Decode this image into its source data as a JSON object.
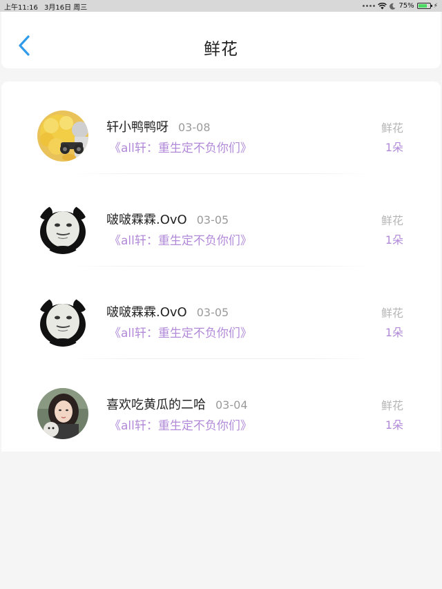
{
  "status_bar": {
    "time": "上午11:16",
    "date": "3月16日 周三",
    "battery_percent": "75%",
    "battery_level": 0.75
  },
  "header": {
    "title": "鲜花",
    "back_icon": "chevron-left-icon",
    "accent": "#2f9bea"
  },
  "colors": {
    "book_title": "#b189d8",
    "meta": "#9a9a9a",
    "background": "#f5f5f6"
  },
  "records": [
    {
      "username": "轩小鸭鸭呀",
      "date": "03-08",
      "book": "《all轩：重生定不负你们》",
      "gift_type": "鲜花",
      "gift_count": "1朵",
      "avatar": "yellow-chick-avatar"
    },
    {
      "username": "啵啵霖霖.OvO",
      "date": "03-05",
      "book": "《all轩：重生定不负你们》",
      "gift_type": "鲜花",
      "gift_count": "1朵",
      "avatar": "panda-meme-avatar"
    },
    {
      "username": "啵啵霖霖.OvO",
      "date": "03-05",
      "book": "《all轩：重生定不负你们》",
      "gift_type": "鲜花",
      "gift_count": "1朵",
      "avatar": "panda-meme-avatar"
    },
    {
      "username": "喜欢吃黄瓜的二哈",
      "date": "03-04",
      "book": "《all轩：重生定不负你们》",
      "gift_type": "鲜花",
      "gift_count": "1朵",
      "avatar": "girl-photo-avatar"
    }
  ]
}
